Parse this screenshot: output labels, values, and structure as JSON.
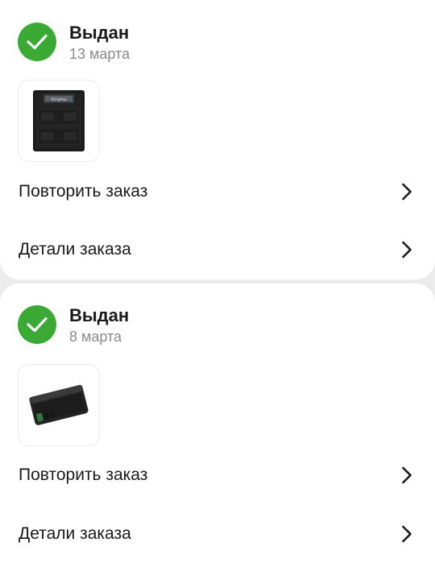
{
  "orders": [
    {
      "status": "Выдан",
      "date": "13 марта",
      "status_color": "#3aaa35",
      "status_icon": "checkmark-icon",
      "product_image": "battery-charger-image",
      "product_brand_mark": "Kingma",
      "repeat_label": "Повторить заказ",
      "details_label": "Детали заказа",
      "chevron_icon": "chevron-right-icon"
    },
    {
      "status": "Выдан",
      "date": "8 марта",
      "status_color": "#3aaa35",
      "status_icon": "checkmark-icon",
      "product_image": "camera-battery-image",
      "repeat_label": "Повторить заказ",
      "details_label": "Детали заказа",
      "chevron_icon": "chevron-right-icon"
    }
  ]
}
